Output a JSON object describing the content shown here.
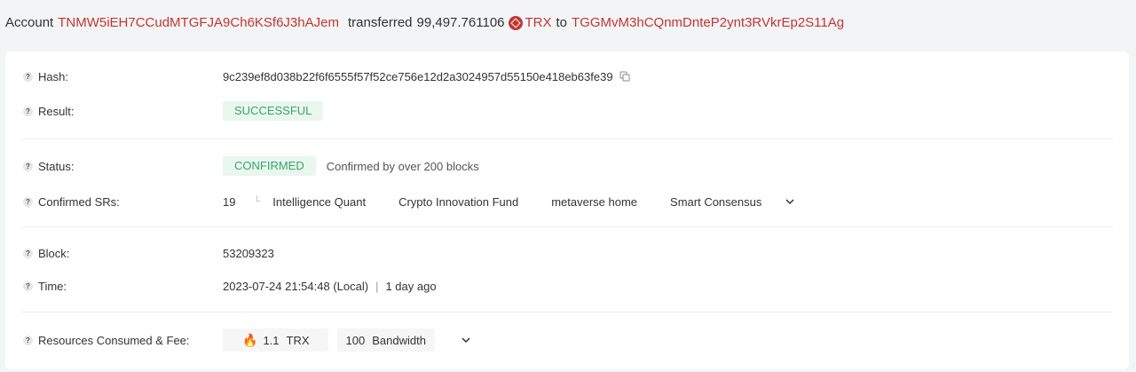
{
  "header": {
    "prefix": "Account",
    "from_address": "TNMW5iEH7CCudMTGFJA9Ch6KSf6J3hAJem",
    "verb": "transferred",
    "amount": "99,497.761106",
    "token": "TRX",
    "to_word": "to",
    "to_address": "TGGMvM3hCQnmDnteP2ynt3RVkrEp2S11Ag"
  },
  "details": {
    "hash_label": "Hash:",
    "hash_value": "9c239ef8d038b22f6f6555f57f52ce756e12d2a3024957d55150e418eb63fe39",
    "result_label": "Result:",
    "result_value": "SUCCESSFUL",
    "status_label": "Status:",
    "status_value": "CONFIRMED",
    "status_note": "Confirmed by over 200 blocks",
    "srs_label": "Confirmed SRs:",
    "srs_count": "19",
    "srs_names": [
      "Intelligence Quant",
      "Crypto Innovation Fund",
      "metaverse home",
      "Smart Consensus"
    ],
    "block_label": "Block:",
    "block_value": "53209323",
    "time_label": "Time:",
    "time_value": "2023-07-24 21:54:48 (Local)",
    "time_separator": "|",
    "time_ago": "1 day ago",
    "fee_label": "Resources Consumed & Fee:",
    "fee_amount": "1.1",
    "fee_token": "TRX",
    "bandwidth_amount": "100",
    "bandwidth_label": "Bandwidth"
  },
  "icons": {
    "help": "question-icon",
    "copy": "copy-icon",
    "chevron": "chevron-down-icon",
    "fire": "fire-icon",
    "token_logo": "trx-logo-icon"
  },
  "colors": {
    "address": "#c23631",
    "success_bg": "#e9f7ee",
    "success_text": "#3aa36b"
  }
}
